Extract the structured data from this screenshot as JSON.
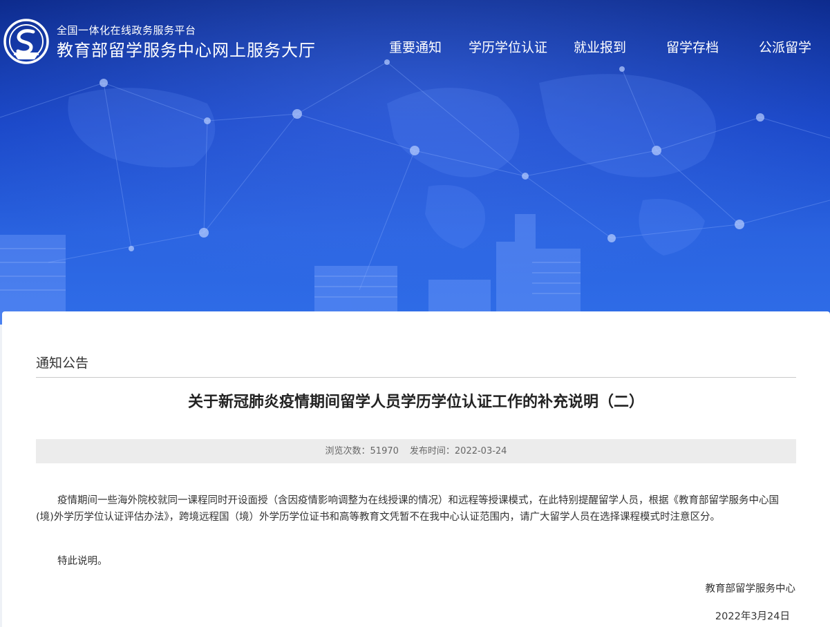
{
  "header": {
    "subtitle": "全国一体化在线政务服务平台",
    "title": "教育部留学服务中心网上服务大厅",
    "nav": [
      {
        "label": "重要通知"
      },
      {
        "label": "学历学位认证"
      },
      {
        "label": "就业报到"
      },
      {
        "label": "留学存档"
      },
      {
        "label": "公派留学"
      }
    ]
  },
  "article": {
    "section": "通知公告",
    "title": "关于新冠肺炎疫情期间留学人员学历学位认证工作的补充说明（二）",
    "views_label": "浏览次数：",
    "views": "51970",
    "date_label": "发布时间：",
    "date": "2022-03-24",
    "paragraphs": [
      "疫情期间一些海外院校就同一课程同时开设面授（含因疫情影响调整为在线授课的情况）和远程等授课模式，在此特别提醒留学人员，根据《教育部留学服务中心国(境)外学历学位认证评估办法》，跨境远程国（境）外学历学位证书和高等教育文凭暂不在我中心认证范围内，请广大留学人员在选择课程模式时注意区分。",
      "特此说明。"
    ],
    "signature_org": "教育部留学服务中心",
    "signature_date": "2022年3月24日"
  },
  "colors": {
    "banner_dark": "#0c2a8c",
    "banner_light": "#2f6de8",
    "text": "#333333",
    "meta_bg": "#ececec"
  },
  "icons": {
    "logo": "ministry-emblem-icon"
  }
}
